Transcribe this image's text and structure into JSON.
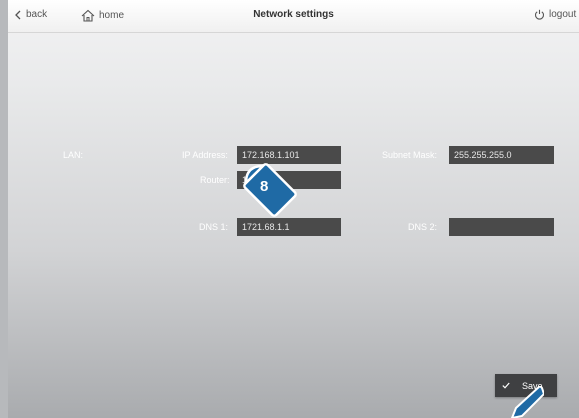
{
  "topbar": {
    "back_label": "back",
    "home_label": "home",
    "title": "Network settings",
    "logout_label": "logout"
  },
  "form": {
    "section_label": "LAN:",
    "ip_label": "IP Address:",
    "ip_value": "172.168.1.101",
    "subnet_label": "Subnet Mask:",
    "subnet_value": "255.255.255.0",
    "router_label": "Router:",
    "router_value": "1",
    "dns1_label": "DNS 1:",
    "dns1_value": "1721.68.1.1",
    "dns2_label": "DNS 2:",
    "dns2_value": ""
  },
  "save_label": "Save",
  "callout_number": "8",
  "icons": {
    "back": "chevron-left-icon",
    "home": "home-icon",
    "logout": "power-icon",
    "save": "check-icon",
    "pointer": "finger-pointer-icon"
  }
}
